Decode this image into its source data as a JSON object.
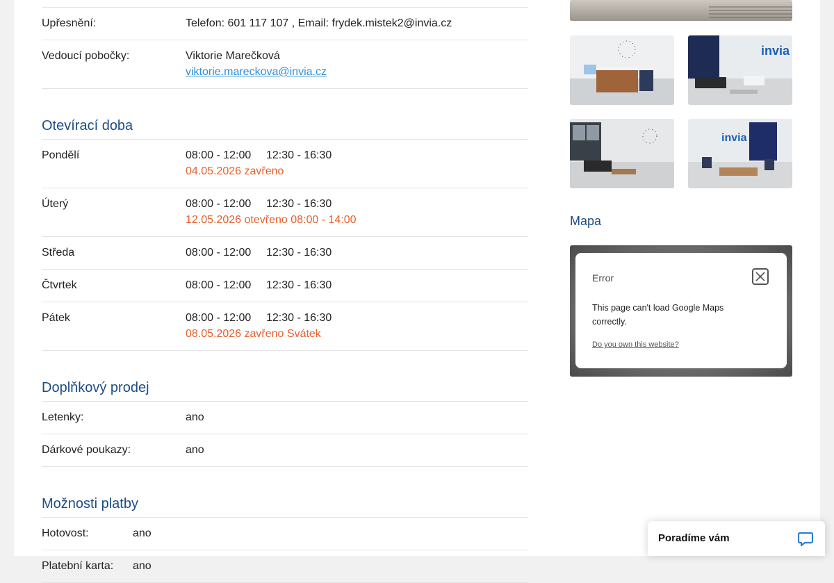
{
  "contact": {
    "upresneni_label": "Upřesnění:",
    "upresneni_value": "Telefon: 601 117 107 , Email: frydek.mistek2@invia.cz",
    "manager_label": "Vedoucí pobočky:",
    "manager_name": "Viktorie Marečková",
    "manager_email": "viktorie.mareckova@invia.cz"
  },
  "opening": {
    "title": "Otevírací doba",
    "days": [
      {
        "day": "Pondělí",
        "morning": "08:00 - 12:00",
        "afternoon": "12:30 - 16:30",
        "note": "04.05.2026 zavřeno"
      },
      {
        "day": "Úterý",
        "morning": "08:00 - 12:00",
        "afternoon": "12:30 - 16:30",
        "note": "12.05.2026 otevřeno 08:00 - 14:00"
      },
      {
        "day": "Středa",
        "morning": "08:00 - 12:00",
        "afternoon": "12:30 - 16:30",
        "note": ""
      },
      {
        "day": "Čtvrtek",
        "morning": "08:00 - 12:00",
        "afternoon": "12:30 - 16:30",
        "note": ""
      },
      {
        "day": "Pátek",
        "morning": "08:00 - 12:00",
        "afternoon": "12:30 - 16:30",
        "note": "08.05.2026 zavřeno Svátek"
      }
    ]
  },
  "extra_sales": {
    "title": "Doplňkový prodej",
    "items": [
      {
        "label": "Letenky:",
        "value": "ano"
      },
      {
        "label": "Dárkové poukazy:",
        "value": "ano"
      }
    ]
  },
  "payment": {
    "title": "Možnosti platby",
    "items": [
      {
        "label": "Hotovost:",
        "value": "ano"
      },
      {
        "label": "Platební karta:",
        "value": "ano"
      }
    ]
  },
  "gallery": {
    "photos": [
      "office-photo-reception",
      "office-photo-lounge-logo",
      "office-photo-window-lounge",
      "office-photo-blue-wall"
    ]
  },
  "map": {
    "title": "Mapa",
    "error_title": "Error",
    "error_message": "This page can't load Google Maps correctly.",
    "error_link": "Do you own this website?"
  },
  "chat": {
    "label": "Poradíme vám",
    "icon": "chat-bubble-icon"
  },
  "colors": {
    "section_title": "#1d4d84",
    "link": "#2f8fd8",
    "note": "#e6602d",
    "chat_icon": "#2c7fd6"
  }
}
